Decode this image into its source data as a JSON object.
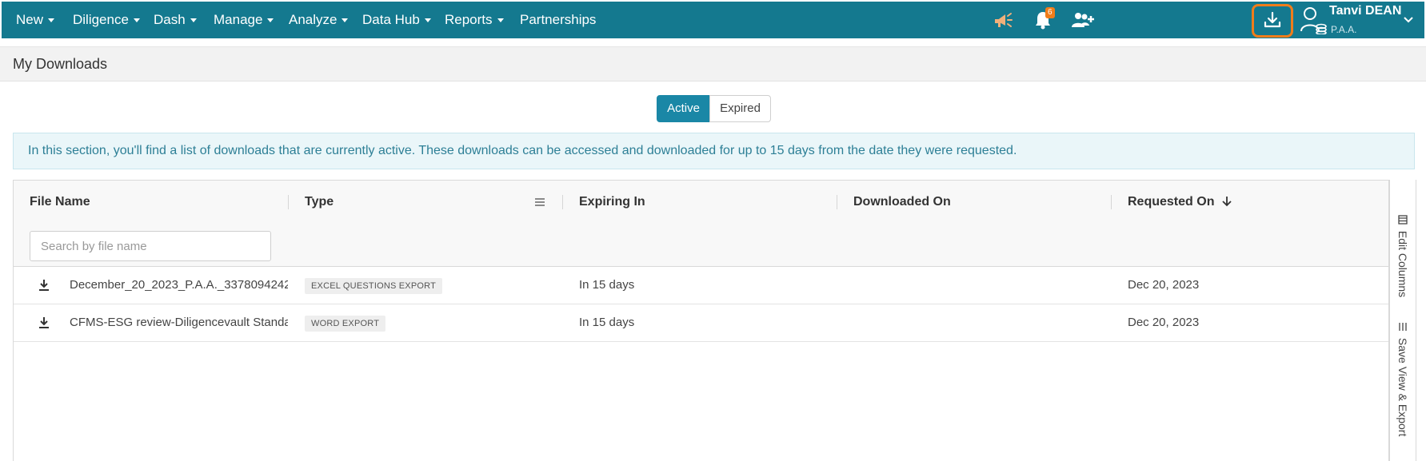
{
  "nav": {
    "items": [
      {
        "label": "New",
        "dropdown": true
      },
      {
        "label": "Diligence",
        "dropdown": true
      },
      {
        "label": "Dash",
        "dropdown": true
      },
      {
        "label": "Manage",
        "dropdown": true
      },
      {
        "label": "Analyze",
        "dropdown": true
      },
      {
        "label": "Data Hub",
        "dropdown": true
      },
      {
        "label": "Reports",
        "dropdown": true
      },
      {
        "label": "Partnerships",
        "dropdown": false
      }
    ],
    "notifications_count": "6",
    "user": {
      "name": "Tanvi DEAN",
      "org": "P.A.A."
    },
    "icons": [
      "megaphone-icon",
      "bell-icon",
      "users-plus-icon",
      "download-icon",
      "user-avatar-icon",
      "chevron-down-icon"
    ],
    "bar_color": "#14798f",
    "highlight_color": "#f07d1a"
  },
  "page": {
    "title": "My Downloads"
  },
  "toggle": {
    "active_label": "Active",
    "expired_label": "Expired"
  },
  "info_text": "In this section, you'll find a list of downloads that are currently active. These downloads can be accessed and downloaded for up to 15 days from the date they were requested.",
  "grid": {
    "columns": [
      "File Name",
      "Type",
      "Expiring In",
      "Downloaded On",
      "Requested On"
    ],
    "search_placeholder": "Search by file name",
    "rows": [
      {
        "file_name": "December_20_2023_P.A.A._3378094242",
        "type": "EXCEL QUESTIONS EXPORT",
        "expiring_in": "In 15 days",
        "downloaded_on": "",
        "requested_on": "Dec 20, 2023"
      },
      {
        "file_name": "CFMS-ESG review-Diligencevault Standa",
        "type": "WORD EXPORT",
        "expiring_in": "In 15 days",
        "downloaded_on": "",
        "requested_on": "Dec 20, 2023"
      }
    ]
  },
  "side_panel": {
    "edit_columns": "Edit Columns",
    "save_view": "Save View & Export"
  }
}
